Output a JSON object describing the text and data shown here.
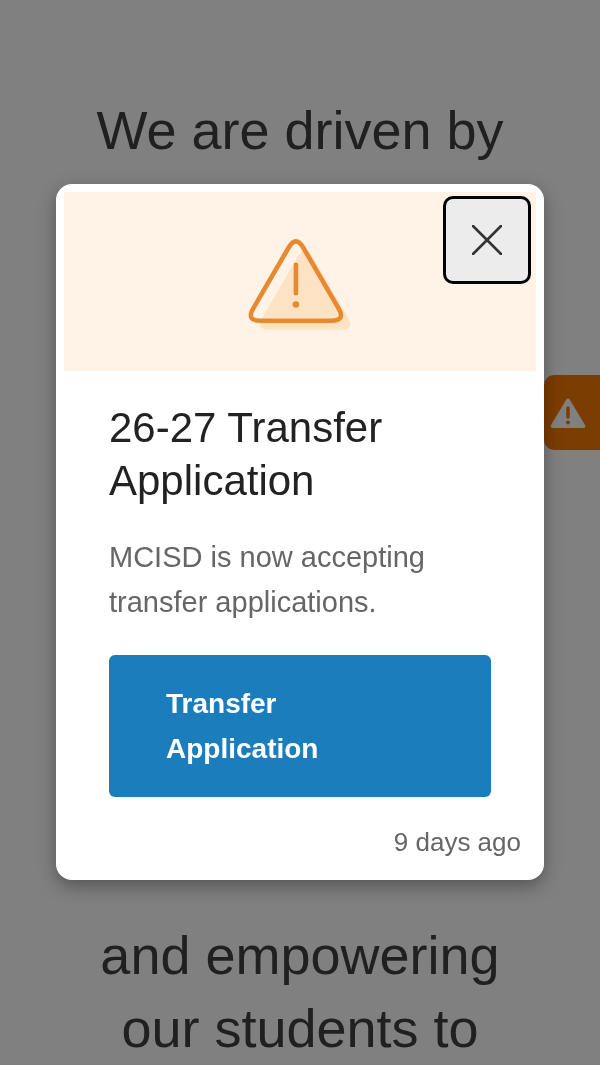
{
  "background_page": {
    "text_lines": [
      "We are driven by",
      "and empowering",
      "our students to"
    ]
  },
  "modal": {
    "title": "26-27 Transfer Application",
    "message": "MCISD is now accepting transfer applications.",
    "button": "Transfer Application",
    "timestamp": "9 days ago"
  }
}
